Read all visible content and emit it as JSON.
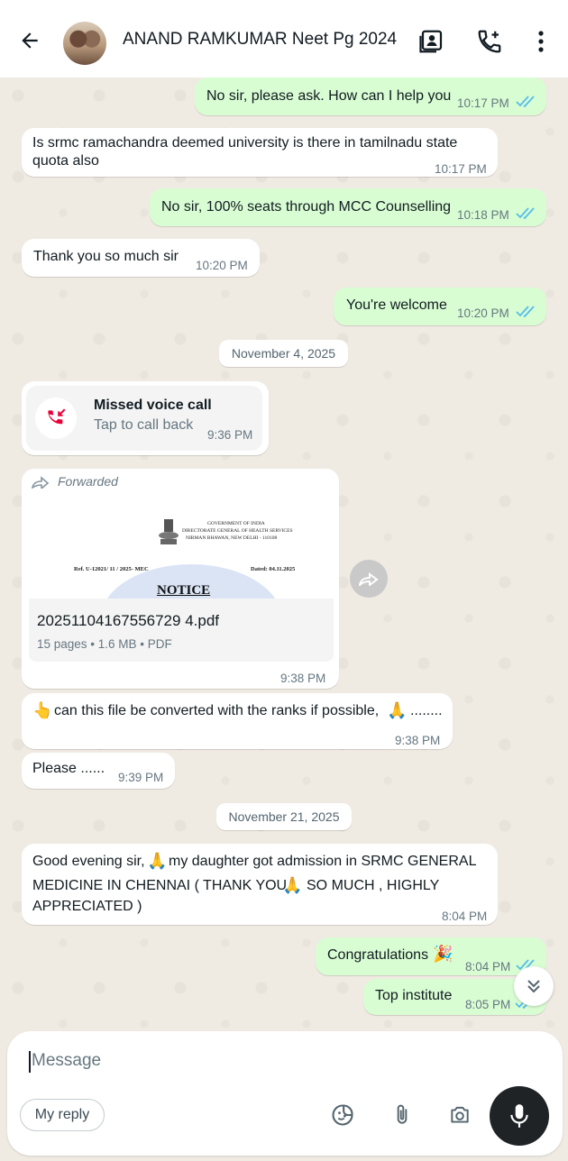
{
  "header": {
    "title": "ANAND RAMKUMAR Neet Pg 2024",
    "back_icon": "arrow-left-icon",
    "icons": [
      "contact-card-icon",
      "add-call-icon",
      "more-vert-icon"
    ]
  },
  "messages": [
    {
      "dir": "out",
      "text": "No sir, please ask. How can I help you",
      "time": "10:17 PM",
      "ticks": "read"
    },
    {
      "dir": "in",
      "lines": [
        "Is srmc ramachandra deemed university is there in tamilnadu state",
        "quota also"
      ],
      "time": "10:17 PM"
    },
    {
      "dir": "out",
      "text": "No sir, 100% seats through MCC Counselling",
      "time": "10:18 PM",
      "ticks": "read"
    },
    {
      "dir": "in",
      "text": "Thank you so much sir",
      "time": "10:20 PM"
    },
    {
      "dir": "out",
      "text": "You're welcome",
      "time": "10:20 PM",
      "ticks": "read"
    },
    {
      "dir": "in",
      "lines": [
        "can this file be converted with the ranks if possible,",
        "........"
      ],
      "time": "9:38 PM"
    },
    {
      "dir": "in",
      "text": "Please ......",
      "time": "9:39 PM"
    },
    {
      "dir": "in",
      "lines": [
        "Good evening sir,",
        "my daughter got admission in SRMC GENERAL",
        "MEDICINE IN CHENNAI ( THANK YOU",
        "SO MUCH , HIGHLY",
        "APPRECIATED )"
      ],
      "time": "8:04 PM"
    },
    {
      "dir": "out",
      "text": "Congratulations",
      "time": "8:04 PM",
      "ticks": "read"
    },
    {
      "dir": "out",
      "text": "Top institute",
      "time": "8:05 PM",
      "ticks": "read"
    }
  ],
  "dates": [
    "November 4, 2025",
    "November 21, 2025"
  ],
  "missed_call": {
    "title": "Missed voice call",
    "subtitle": "Tap to call back",
    "time": "9:36 PM"
  },
  "document": {
    "forwarded_label": "Forwarded",
    "preview": {
      "line1": "GOVERNMENT OF INDIA",
      "line2": "DIRECTORATE GENERAL OF HEALTH SERVICES",
      "line3": "NIRMAN BHAWAN, NEW DELHI - 110108",
      "ref": "Ref. U-12021/ 11 / 2025- MEC",
      "dated": "Dated: 04.11.2025",
      "notice": "NOTICE"
    },
    "filename": "20251104167556729 4.pdf",
    "meta": "15 pages • 1.6 MB • PDF",
    "time": "9:38 PM"
  },
  "input": {
    "placeholder": "Message",
    "chip": "My reply",
    "icons": [
      "sticker-icon",
      "attach-icon",
      "camera-icon",
      "mic-icon"
    ]
  },
  "colors": {
    "outgoing": "#d9fdd3",
    "incoming": "#ffffff",
    "background": "#efeae2",
    "read_ticks": "#53bdeb",
    "missed_call": "#ea0038"
  }
}
